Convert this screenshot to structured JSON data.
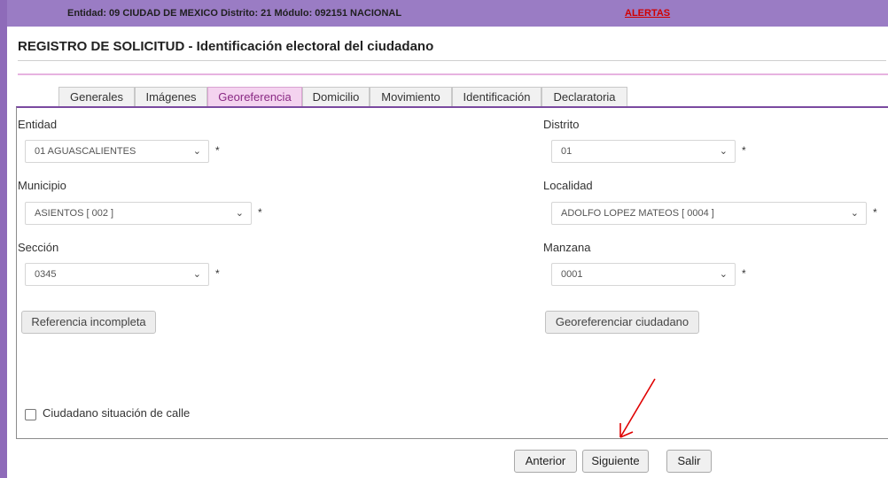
{
  "header": {
    "info": "Entidad: 09 CIUDAD DE MEXICO Distrito: 21 Módulo: 092151 NACIONAL",
    "alerts": "ALERTAS"
  },
  "page_title": "REGISTRO DE SOLICITUD - Identificación electoral del ciudadano",
  "tabs": [
    {
      "label": "Generales"
    },
    {
      "label": "Imágenes"
    },
    {
      "label": "Georeferencia",
      "active": true
    },
    {
      "label": "Domicilio"
    },
    {
      "label": "Movimiento"
    },
    {
      "label": "Identificación"
    },
    {
      "label": "Declaratoria"
    }
  ],
  "form": {
    "entidad": {
      "label": "Entidad",
      "value": "01 AGUASCALIENTES"
    },
    "distrito": {
      "label": "Distrito",
      "value": "01"
    },
    "municipio": {
      "label": "Municipio",
      "value": "ASIENTOS [ 002 ]"
    },
    "localidad": {
      "label": "Localidad",
      "value": "ADOLFO LOPEZ MATEOS [ 0004 ]"
    },
    "seccion": {
      "label": "Sección",
      "value": "0345"
    },
    "manzana": {
      "label": "Manzana",
      "value": "0001"
    },
    "required_mark": "*",
    "referencia_button": "Referencia incompleta",
    "georef_button": "Georeferenciar ciudadano",
    "situacion_calle_label": "Ciudadano situación de calle",
    "situacion_calle_checked": false
  },
  "footer": {
    "anterior": "Anterior",
    "siguiente": "Siguiente",
    "salir": "Salir"
  },
  "colors": {
    "topbar": "#9a7cc4",
    "active_tab": "#f4d3ef",
    "alert": "#d00000",
    "annotation_arrow": "#e00000"
  },
  "icons": {
    "select_chevron": "chevron-down-icon",
    "annotation": "red-arrow-icon"
  }
}
